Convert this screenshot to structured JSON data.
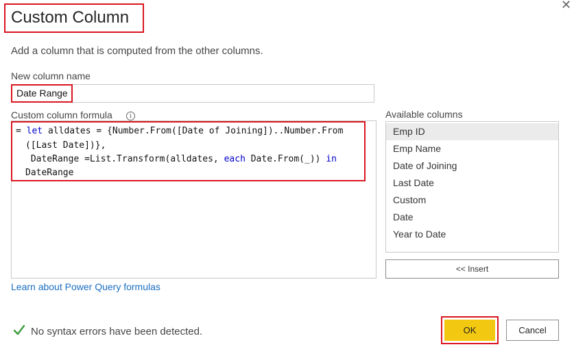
{
  "dialog": {
    "title": "Custom Column",
    "close_glyph": "✕",
    "subtitle": "Add a column that is computed from the other columns."
  },
  "new_column": {
    "label": "New column name",
    "value": "Date Range"
  },
  "formula": {
    "label": "Custom column formula",
    "info_glyph": "i",
    "line1_a": "= ",
    "line1_kw": "let",
    "line1_b": " alldates = {Number.From([Date of Joining])..Number.From",
    "line2": "([Last Date])},",
    "line3_a": " DateRange =List.Transform(alldates, ",
    "line3_kw1": "each",
    "line3_b": " Date.From(_)) ",
    "line3_kw2": "in",
    "line4": "DateRange"
  },
  "learn_link": "Learn about Power Query formulas",
  "available": {
    "label": "Available columns",
    "items": [
      "Emp ID",
      "Emp Name",
      "Date of Joining",
      "Last Date",
      "Custom",
      "Date",
      "Year to Date"
    ],
    "selected": "Emp ID",
    "insert_label": "<< Insert"
  },
  "status": {
    "icon": "check-icon",
    "text": "No syntax errors have been detected."
  },
  "buttons": {
    "ok_label": "OK",
    "cancel_label": "Cancel"
  },
  "colors": {
    "highlight_border": "#d9141e",
    "ok_button": "#f2c811",
    "link": "#1b6ec2",
    "check": "#3a9a3a",
    "keyword": "#0000cc"
  }
}
